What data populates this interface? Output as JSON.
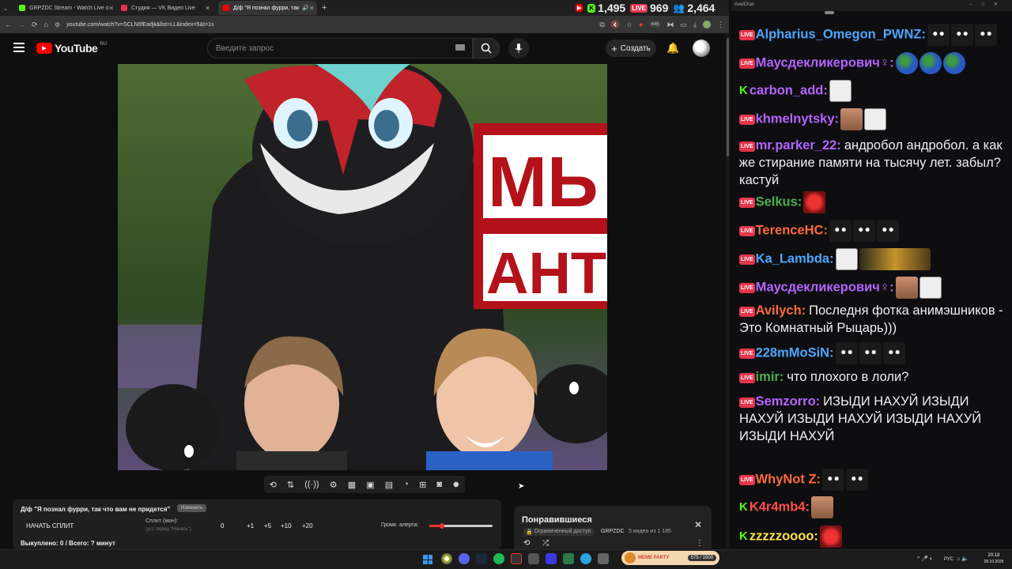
{
  "browser": {
    "tabs": [
      {
        "title": "GRPZDC Stream - Watch Live o",
        "color": "#53fc18",
        "glyph": "K"
      },
      {
        "title": "Студия — VK Видео Live",
        "color": "#e4364d",
        "glyph": ""
      },
      {
        "title": "Д/ф \"Я познал фурри, так",
        "color": "#ff0000",
        "glyph": "▶"
      }
    ],
    "new_tab_icon": "plus-icon",
    "url": "youtube.com/watch?v=SCLN0fEadjk&list=LL&index=5&t=1s",
    "download_badge": "445"
  },
  "stats": {
    "youtube_count": "",
    "kick_count": "1,495",
    "vk_count": "969",
    "viewers_count": "2,464"
  },
  "youtube": {
    "logo_text": "YouTube",
    "region": "RU",
    "search_placeholder": "Введите запрос",
    "create_label": "Создать"
  },
  "video": {
    "sign_line1": "МЬ",
    "sign_line2": "АНТИ"
  },
  "toolbar": {
    "icons": [
      "loop-icon",
      "sort-icon",
      "broadcast-icon",
      "camera-settings-icon",
      "clapper-icon",
      "pip-icon",
      "subtitles-icon",
      "speed-icon",
      "add-clip-icon",
      "screenshot-icon",
      "settings-icon"
    ]
  },
  "split_panel": {
    "title": "Д/ф \"Я познал фурри, так что вам не придется\"",
    "title_button": "Изменить",
    "start_split": "НАЧАТЬ СПЛИТ",
    "split_label": "Сплит (мин):",
    "split_hint": "(уст. перед \"Начать\")",
    "split_value": "0",
    "increments": [
      "+1",
      "+5",
      "+10",
      "+20"
    ],
    "volume_label": "Громк. алерта:",
    "volume_level": 0.2,
    "bought": "Выкуплено: 0 / Всего: ? минут"
  },
  "playlist": {
    "title": "Понравившиеся",
    "access": "Ограниченный доступ",
    "owner": "GRPZDC",
    "position": "5 видео из 1 185"
  },
  "chat": {
    "window_title": "AxelChat",
    "messages": [
      {
        "source": "vk",
        "user": "Alpharius_Omegon_PWNZ:",
        "color": "#4ea6ff",
        "text": "",
        "emotes": [
          "cat",
          "cat",
          "cat"
        ]
      },
      {
        "source": "vk",
        "user": "Маусдекликерович♀:",
        "color": "#b464ff",
        "text": "",
        "emotes": [
          "globe",
          "globe",
          "globe"
        ]
      },
      {
        "source": "kick",
        "user": "carbon_add:",
        "color": "#b464ff",
        "text": "",
        "emotes": [
          "drawn"
        ]
      },
      {
        "source": "vk",
        "user": "khmelnytsky:",
        "color": "#b464ff",
        "text": "",
        "emotes": [
          "face",
          "drawn"
        ]
      },
      {
        "source": "vk",
        "user": "mr.parker_22:",
        "color": "#b464ff",
        "text": "андробол андробол. а как же стирание памяти на тысячу лет. забыл? кастуй",
        "emotes": []
      },
      {
        "source": "vk",
        "user": "Selkus:",
        "color": "#4caf50",
        "text": "",
        "emotes": [
          "devil"
        ]
      },
      {
        "source": "vk",
        "user": "TerenceHC:",
        "color": "#ff6a3d",
        "text": "",
        "emotes": [
          "cat",
          "cat",
          "cat"
        ]
      },
      {
        "source": "vk",
        "user": "Ka_Lambda:",
        "color": "#4ea6ff",
        "text": "",
        "emotes": [
          "drawn",
          "wide"
        ]
      },
      {
        "source": "vk",
        "user": "Маусдекликерович♀:",
        "color": "#b464ff",
        "text": "",
        "emotes": [
          "face",
          "drawn"
        ]
      },
      {
        "source": "vk",
        "user": "Avilych:",
        "color": "#ff6a3d",
        "text": "Последня фотка анимэшников - Это Комнатный Рыцарь)))",
        "emotes": []
      },
      {
        "source": "vk",
        "user": "228mMoSiN:",
        "color": "#4ea6ff",
        "text": "",
        "emotes": [
          "cat",
          "cat",
          "cat"
        ]
      },
      {
        "source": "vk",
        "user": "imir:",
        "color": "#4caf50",
        "text": "что плохого в лоли?",
        "emotes": []
      },
      {
        "source": "vk",
        "user": "Semzorro:",
        "color": "#b464ff",
        "text": "ИЗЫДИ НАХУЙ  ИЗЫДИ НАХУЙ  ИЗЫДИ НАХУЙ  ИЗЫДИ НАХУЙ  ИЗЫДИ НАХУЙ",
        "emotes": []
      },
      {
        "source": "vk",
        "user": "WhyNot Z:",
        "color": "#ff6a3d",
        "text": "",
        "emotes": [
          "cat",
          "cat"
        ]
      },
      {
        "source": "kick",
        "user": "K4r4mb4:",
        "color": "#ff4d4d",
        "text": "",
        "emotes": [
          "face"
        ]
      },
      {
        "source": "kick",
        "user": "zzzzzoooo:",
        "color": "#ffe14d",
        "text": "",
        "emotes": [
          "devil"
        ]
      }
    ]
  },
  "taskbar": {
    "meme_party": "MEME PARTY",
    "meme_progress": "575 / 1500",
    "lang": "РУС",
    "time": "20:18",
    "date": "28.10.2025"
  }
}
